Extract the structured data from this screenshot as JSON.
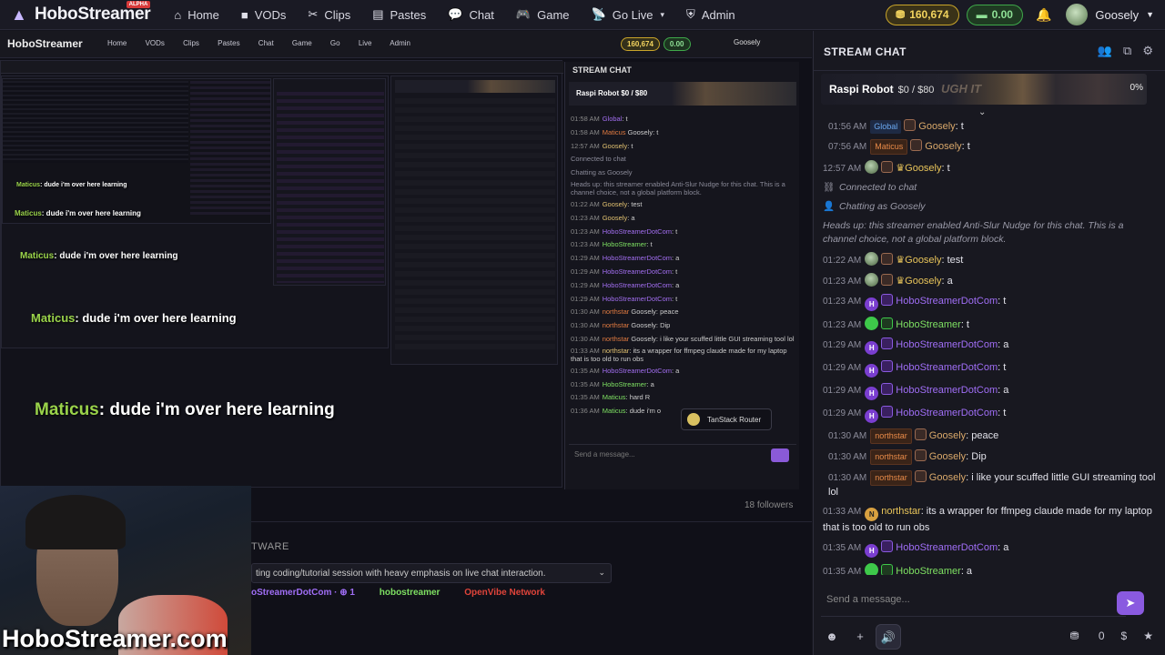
{
  "nav": {
    "brand": "HoboStreamer",
    "alpha": "ALPHA",
    "items": [
      {
        "icon": "⌂",
        "label": "Home"
      },
      {
        "icon": "■",
        "label": "VODs"
      },
      {
        "icon": "✂",
        "label": "Clips"
      },
      {
        "icon": "▤",
        "label": "Pastes"
      },
      {
        "icon": "💬",
        "label": "Chat"
      },
      {
        "icon": "🎮",
        "label": "Game"
      },
      {
        "icon": "📡",
        "label": "Go Live",
        "caret": "▾"
      },
      {
        "icon": "⛨",
        "label": "Admin"
      }
    ],
    "gold": "160,674",
    "cash": "0.00",
    "user": "Goosely"
  },
  "stream": {
    "watermark": "HoboStreamer.com",
    "overlay_lines": [
      {
        "name": "Maticus",
        "text": ": dude i'm over here learning"
      },
      {
        "name": "Maticus",
        "text": ": dude i'm over here learning"
      },
      {
        "name": "Maticus",
        "text": ": dude i'm over here learning"
      },
      {
        "name": "Maticus",
        "text": ": dude i'm over here learning"
      }
    ],
    "rec_brand": "HoboStreamer",
    "rec_links": "Home VODs Clips Pastes Chat Game Go Live Admin",
    "rec_gold": "160,674",
    "rec_cash": "0.00",
    "rec_user": "Goosely",
    "rec_chat_title": "STREAM CHAT",
    "rec_banner": "Raspi Robot  $0 / $80",
    "rec_msgs": [
      {
        "t": "01:58 AM",
        "u": "Global",
        "c": "p",
        "m": ": t"
      },
      {
        "t": "01:58 AM",
        "u": "Maticus",
        "c": "o",
        "m": " Goosely: t"
      },
      {
        "t": "12:57 AM",
        "u": "Goosely",
        "c": "y",
        "m": ": t"
      },
      {
        "t": "",
        "u": "",
        "c": "",
        "m": "Connected to chat"
      },
      {
        "t": "",
        "u": "",
        "c": "",
        "m": "Chatting as Goosely"
      },
      {
        "t": "",
        "u": "",
        "c": "",
        "m": "Heads up: this streamer enabled Anti-Slur Nudge for this chat. This is a channel choice, not a global platform block."
      },
      {
        "t": "01:22 AM",
        "u": "Goosely",
        "c": "y",
        "m": ": test"
      },
      {
        "t": "01:23 AM",
        "u": "Goosely",
        "c": "y",
        "m": ": a"
      },
      {
        "t": "01:23 AM",
        "u": "HoboStreamerDotCom",
        "c": "p",
        "m": ": t"
      },
      {
        "t": "01:23 AM",
        "u": "HoboStreamer",
        "c": "g",
        "m": ": t"
      },
      {
        "t": "01:29 AM",
        "u": "HoboStreamerDotCom",
        "c": "p",
        "m": ": a"
      },
      {
        "t": "01:29 AM",
        "u": "HoboStreamerDotCom",
        "c": "p",
        "m": ": t"
      },
      {
        "t": "01:29 AM",
        "u": "HoboStreamerDotCom",
        "c": "p",
        "m": ": a"
      },
      {
        "t": "01:29 AM",
        "u": "HoboStreamerDotCom",
        "c": "p",
        "m": ": t"
      },
      {
        "t": "01:30 AM",
        "u": "northstar",
        "c": "o",
        "m": " Goosely: peace"
      },
      {
        "t": "01:30 AM",
        "u": "northstar",
        "c": "o",
        "m": " Goosely: Dip"
      },
      {
        "t": "01:30 AM",
        "u": "northstar",
        "c": "o",
        "m": " Goosely: i like your scuffed little GUI streaming tool lol"
      },
      {
        "t": "01:33 AM",
        "u": "northstar",
        "c": "y",
        "m": ": its a wrapper for ffmpeg claude made for my laptop that is too old to run obs"
      },
      {
        "t": "01:35 AM",
        "u": "HoboStreamerDotCom",
        "c": "p",
        "m": ": a"
      },
      {
        "t": "01:35 AM",
        "u": "HoboStreamer",
        "c": "g",
        "m": ": a"
      },
      {
        "t": "01:35 AM",
        "u": "Maticus",
        "c": "g",
        "m": ": hard R"
      },
      {
        "t": "01:36 AM",
        "u": "Maticus",
        "c": "g",
        "m": ": dude i'm o"
      }
    ],
    "rec_input": "Send a message...",
    "tanstack": "TanStack Router",
    "followers": "18 followers",
    "section": "TWARE",
    "desc": "ting coding/tutorial session with heavy emphasis on live chat interaction.",
    "link1": "oStreamerDotCom · ⊕ 1",
    "link2": "hobostreamer",
    "link3": "OpenVibe Network"
  },
  "chat": {
    "title": "STREAM CHAT",
    "banner_name": "Raspi Robot",
    "banner_price": "$0 / $80",
    "banner_over": "UGH IT",
    "banner_pct": "0%",
    "messages": [
      {
        "type": "msg",
        "ts": "01:56 AM",
        "indent": true,
        "tag": "Global",
        "tagcls": "gtag",
        "shield": true,
        "name": "Goosely",
        "cls": "u-tan",
        "text": ": t"
      },
      {
        "type": "msg",
        "ts": "07:56 AM",
        "indent": true,
        "tag": "Maticus",
        "tagcls": "tag",
        "shield": true,
        "name": "Goosely",
        "cls": "u-tan",
        "text": ": t"
      },
      {
        "type": "msg",
        "ts": "12:57 AM",
        "icon": "av",
        "shield": true,
        "crown": true,
        "name": "Goosely",
        "cls": "u-gold",
        "text": ": t"
      },
      {
        "type": "sys",
        "icon": "⛓",
        "text": "Connected to chat"
      },
      {
        "type": "sys",
        "icon": "👤",
        "text": "Chatting as Goosely"
      },
      {
        "type": "note",
        "text": "Heads up: this streamer enabled Anti-Slur Nudge for this chat. This is a channel choice, not a global platform block."
      },
      {
        "type": "msg",
        "ts": "01:22 AM",
        "icon": "av",
        "shield": true,
        "crown": true,
        "name": "Goosely",
        "cls": "u-gold",
        "text": ": test"
      },
      {
        "type": "msg",
        "ts": "01:23 AM",
        "icon": "av",
        "shield": true,
        "crown": true,
        "name": "Goosely",
        "cls": "u-gold",
        "text": ": a"
      },
      {
        "type": "msg",
        "ts": "01:23 AM",
        "icon": "H",
        "iconcls": "ic-p",
        "badge": "p",
        "name": "HoboStreamerDotCom",
        "cls": "u-purple",
        "text": ": t"
      },
      {
        "type": "msg",
        "ts": "01:23 AM",
        "icon": "g",
        "iconcls": "ic-g",
        "badge": "g",
        "name": "HoboStreamer",
        "cls": "u-green",
        "text": ": t"
      },
      {
        "type": "msg",
        "ts": "01:29 AM",
        "icon": "H",
        "iconcls": "ic-p",
        "badge": "p",
        "name": "HoboStreamerDotCom",
        "cls": "u-purple",
        "text": ": a"
      },
      {
        "type": "msg",
        "ts": "01:29 AM",
        "icon": "H",
        "iconcls": "ic-p",
        "badge": "p",
        "name": "HoboStreamerDotCom",
        "cls": "u-purple",
        "text": ": t"
      },
      {
        "type": "msg",
        "ts": "01:29 AM",
        "icon": "H",
        "iconcls": "ic-p",
        "badge": "p",
        "name": "HoboStreamerDotCom",
        "cls": "u-purple",
        "text": ": a"
      },
      {
        "type": "msg",
        "ts": "01:29 AM",
        "icon": "H",
        "iconcls": "ic-p",
        "badge": "p",
        "name": "HoboStreamerDotCom",
        "cls": "u-purple",
        "text": ": t"
      },
      {
        "type": "msg",
        "ts": "01:30 AM",
        "indent": true,
        "tag": "northstar",
        "tagcls": "tag",
        "shield": true,
        "name": "Goosely",
        "cls": "u-tan",
        "text": ": peace"
      },
      {
        "type": "msg",
        "ts": "01:30 AM",
        "indent": true,
        "tag": "northstar",
        "tagcls": "tag",
        "shield": true,
        "name": "Goosely",
        "cls": "u-tan",
        "text": ": Dip"
      },
      {
        "type": "msg",
        "ts": "01:30 AM",
        "indent": true,
        "tag": "northstar",
        "tagcls": "tag",
        "shield": true,
        "name": "Goosely",
        "cls": "u-tan",
        "text": ": i like your scuffed little GUI streaming tool lol"
      },
      {
        "type": "msg",
        "ts": "01:33 AM",
        "icon": "N",
        "iconcls": "ic-n",
        "name": "northstar",
        "cls": "u-gold",
        "text": ": its a wrapper for ffmpeg claude made for my laptop that is too old to run obs"
      },
      {
        "type": "msg",
        "ts": "01:35 AM",
        "icon": "H",
        "iconcls": "ic-p",
        "badge": "p",
        "name": "HoboStreamerDotCom",
        "cls": "u-purple",
        "text": ": a"
      },
      {
        "type": "msg",
        "ts": "01:35 AM",
        "icon": "g",
        "iconcls": "ic-g",
        "badge": "g",
        "name": "HoboStreamer",
        "cls": "u-green",
        "text": ": a"
      },
      {
        "type": "msg",
        "ts": "01:35 AM",
        "icon": "m",
        "iconcls": "ic-m",
        "shield": true,
        "name": "Maticus",
        "cls": "u-olive",
        "text": ": hard R"
      },
      {
        "type": "msg",
        "ts": "01:36 AM",
        "icon": "m",
        "iconcls": "ic-m",
        "shield": true,
        "name": "Maticus",
        "cls": "u-olive",
        "text": ": dude i'm over here learning"
      }
    ],
    "input_placeholder": "Send a message...",
    "gifts": "0",
    "dollar": "$"
  }
}
